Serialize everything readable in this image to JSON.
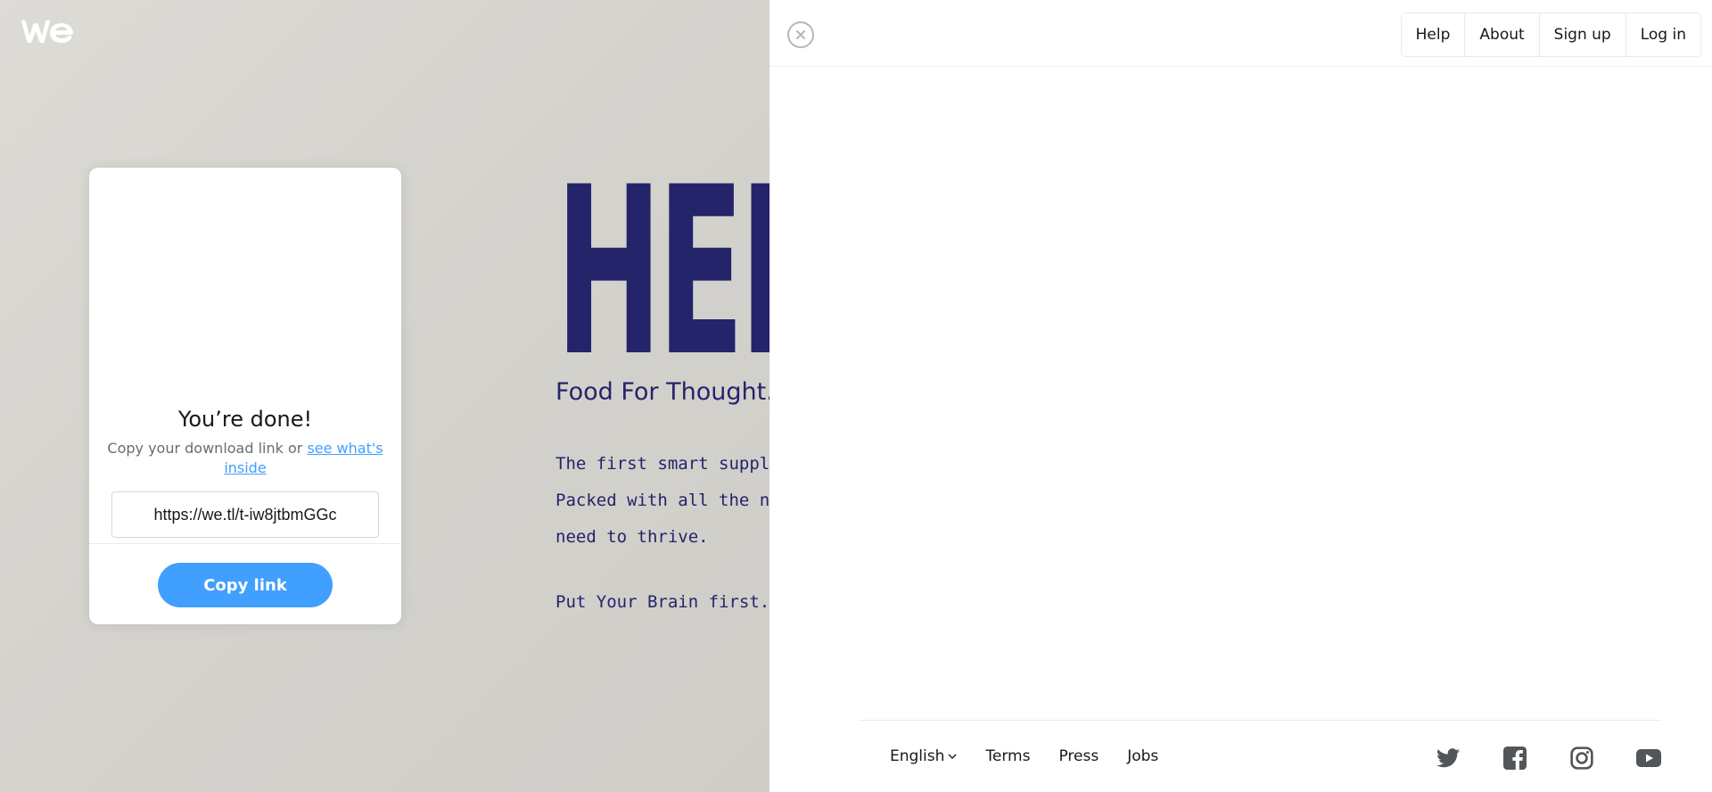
{
  "ad": {
    "headline": "HEIGHT",
    "subtitle": "Food For Thought.",
    "body_lines": [
      "The first smart suppleme",
      "Packed with all the natu",
      "need to thrive."
    ],
    "tagline": "Put Your Brain first.",
    "color": "#24246b"
  },
  "card": {
    "title": "You’re done!",
    "desc_prefix": "Copy your download link or ",
    "desc_link": "see what's inside",
    "link_value": "https://we.tl/t-iw8jtbmGGc",
    "copy_label": "Copy link",
    "accent": "#409fff"
  },
  "nav": {
    "items": [
      {
        "label": "Help"
      },
      {
        "label": "About"
      },
      {
        "label": "Sign up"
      },
      {
        "label": "Log in"
      }
    ]
  },
  "footer": {
    "language": "English",
    "links": [
      {
        "label": "Terms"
      },
      {
        "label": "Press"
      },
      {
        "label": "Jobs"
      }
    ],
    "socials": [
      "twitter-icon",
      "facebook-icon",
      "instagram-icon",
      "youtube-icon"
    ]
  },
  "icons": {
    "logo": "wetransfer-logo-icon",
    "close": "close-icon",
    "language_chevron": "chevron-down-icon"
  }
}
